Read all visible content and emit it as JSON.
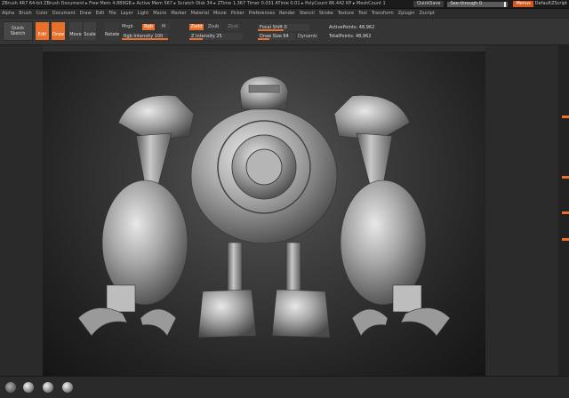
{
  "titlebar": {
    "title": "ZBrush 4R7 64-bit  ZBrush Document  ▸ Free Mem 4.889GB ▸ Active Mem 567 ▸ Scratch Disk 34 ▸ ZTime 1.367 Timer 0.031 ATime 0.01 ▸ PolyCount 86.442 KP ▸ MeshCount 1",
    "quicksave": "QuickSave",
    "seethrough": "See-through 0",
    "menus": "Menus",
    "default_script": "DefaultZScript"
  },
  "menubar": {
    "items": [
      "Alpha",
      "Brush",
      "Color",
      "Document",
      "Draw",
      "Edit",
      "File",
      "Layer",
      "Light",
      "Macro",
      "Marker",
      "Material",
      "Movie",
      "Picker",
      "Preferences",
      "Render",
      "Stencil",
      "Stroke",
      "Texture",
      "Tool",
      "Transform",
      "Zplugin",
      "Zscript"
    ]
  },
  "shelf": {
    "quick_sketch": "Quick Sketch",
    "edit": "Edit",
    "draw": "Draw",
    "move": "Move",
    "scale": "Scale",
    "rotate": "Rotate",
    "mrgb": "Mrgb",
    "rgb": "Rgb",
    "m": "M",
    "rgb_intensity": "Rgb Intensity 100",
    "zadd": "Zadd",
    "zsub": "Zsub",
    "zcut": "Zcut",
    "z_intensity": "Z Intensity 25",
    "focal_shift": "Focal Shift 0",
    "draw_size": "Draw Size 64",
    "dynamic": "Dynamic",
    "active_points": "ActivePoints: 48,962",
    "total_points": "TotalPoints: 48,962"
  },
  "sliders": {
    "rgb_intensity": 1.0,
    "z_intensity": 0.25,
    "focal_shift": 0.5,
    "draw_size": 0.3
  },
  "colors": {
    "accent": "#e8702a",
    "panel": "#2b2b2b",
    "canvas_center": "#5a5a5a"
  }
}
